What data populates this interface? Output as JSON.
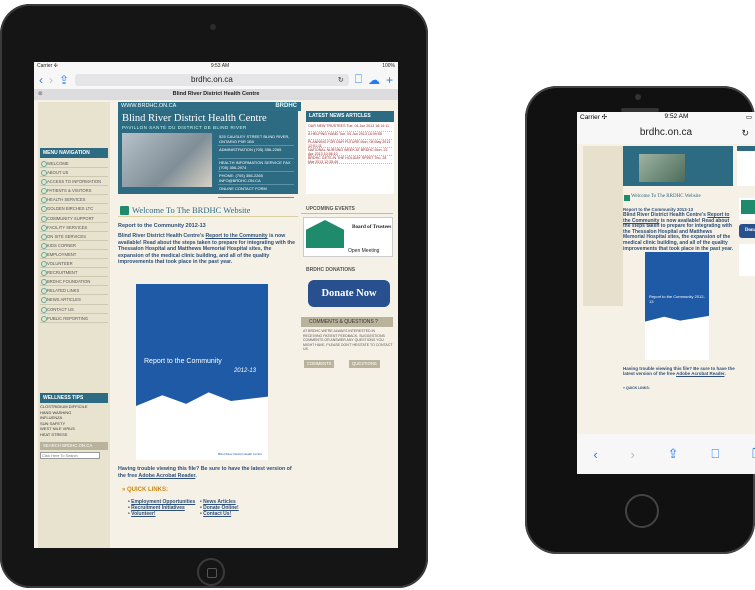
{
  "ipad": {
    "status": {
      "carrier": "Carrier ✣",
      "time": "9:53 AM",
      "battery": "100%"
    },
    "url": "brdhc.on.ca",
    "tab_title": "Blind River District Health Centre"
  },
  "site": {
    "url_strip": "WWW.BRDHC.ON.CA",
    "logo": "BRDHC",
    "title": "Blind River District Health Centre",
    "subtitle": "PAVILLON SANTÉ DU DISTRICT DE BLIND RIVER",
    "address": "525 CAUSLEY STREET BLIND RIVER, ONTARIO P0R 1B0",
    "admin": "ADMINISTRATION (705) 356-2265",
    "info": "HEALTH INFORMATION SERVICE FAX (705) 356-2974",
    "phone": "PHONE: (705) 356-2265 INFO@BRDHC.ON.CA",
    "contact": "ONLINE CONTACT FORM",
    "news_head": "LATEST NEWS ARTICLES",
    "news": [
      "OUR NEW TRUSTEES  Tue, 04 Jun 2013 16:14:11",
      "A HELPING HAND  Tue, 04 Jun 2013 16:09:55",
      "PLANNING FOR OUR FUTURE  Mon, 08 May 2013 12:01:11",
      "NATIONAL NURSING WEEK AT BRDHC  Mon, 22 Apr 2013 10:36:10",
      "BRDHC GETS IN THE HOLIDAY SPIRIT  Thu, 28 Mar 2013 12:35:49"
    ],
    "menu_head": "MENU NAVIGATION",
    "menu": [
      "WELCOME",
      "ABOUT US",
      "ACCESS TO INFORMATION",
      "PATIENTS & VISITORS",
      "HEALTH SERVICES",
      "GOLDEN BIRCHES LTC",
      "COMMUNITY SUPPORT",
      "FACILITY SERVICES",
      "ON SITE SERVICES",
      "KIDS CORNER",
      "EMPLOYMENT",
      "VOLUNTEER",
      "RECRUITMENT",
      "BRDHC FOUNDATION",
      "RELATED LINKS",
      "NEWS ARTICLES",
      "CONTACT US",
      "PUBLIC REPORTING"
    ],
    "wellness_head": "WELLNESS TIPS",
    "wellness": [
      "CLOSTRIDIUM DIFFICILE",
      "HAND WASHING",
      "INFLUENZA",
      "SUN SAFETY",
      "WEST NILE VIRUS",
      "HEAT STRESS"
    ],
    "search_label": "SEARCH BRDHC.ON.CA",
    "search_placeholder": "Click Here To Search",
    "welcome": "Welcome To The BRDHC Website",
    "report_title": "Report to the Community 2012-13",
    "intro_a": "Blind River District Health Centre's ",
    "intro_link": "Report to the Community",
    "intro_b": " is now available! Read about the steps taken to prepare for integrating with the Thessalon Hospital and Matthews Memorial Hospital sites, the expansion of the medical clinic building, and all of the quality improvements that took place in the past year.",
    "cover_title": "Report to the Community",
    "cover_year": "2012-13",
    "cover_foot": "Blind River District Health Centre",
    "trouble_a": "Having trouble viewing this file? Be sure to have the latest version of the free ",
    "trouble_link": "Adobe Acrobat Reader",
    "quick_head": "» QUICK LINKS:",
    "quick_left": [
      "Employment Opportunities",
      "Recruitment Initiatives",
      "Volunteer!"
    ],
    "quick_right": [
      "News Articles",
      "Donate Online!",
      "Contact Us!"
    ],
    "events_head": "UPCOMING EVENTS",
    "event_title": "Board of Trustees",
    "event_time": "Open Meeting",
    "donations_head": "BRDHC DONATIONS",
    "donate": "Donate Now",
    "comments_head": "COMMENTS & QUESTIONS ?",
    "comments_text": "AT BRDHC WE'RE ALWAYS INTERESTED IN RECEIVING PATIENT FEEDBACK, SUGGESTIONS COMMENTS OR ANSWER ANY QUESTIONS YOU MIGHT HAVE, PLEASE DON'T HESITATE TO CONTACT US.",
    "comments_btn": "COMMENTS",
    "questions_btn": "QUESTIONS"
  },
  "iphone": {
    "status": {
      "carrier": "Carrier ✣",
      "time": "9:52 AM"
    },
    "url": "brdhc.on.ca"
  },
  "colors": {
    "teal": "#2d6b83",
    "blue": "#1e5aa5",
    "green": "#1e8b6c",
    "ios_blue": "#1f7cf6"
  }
}
